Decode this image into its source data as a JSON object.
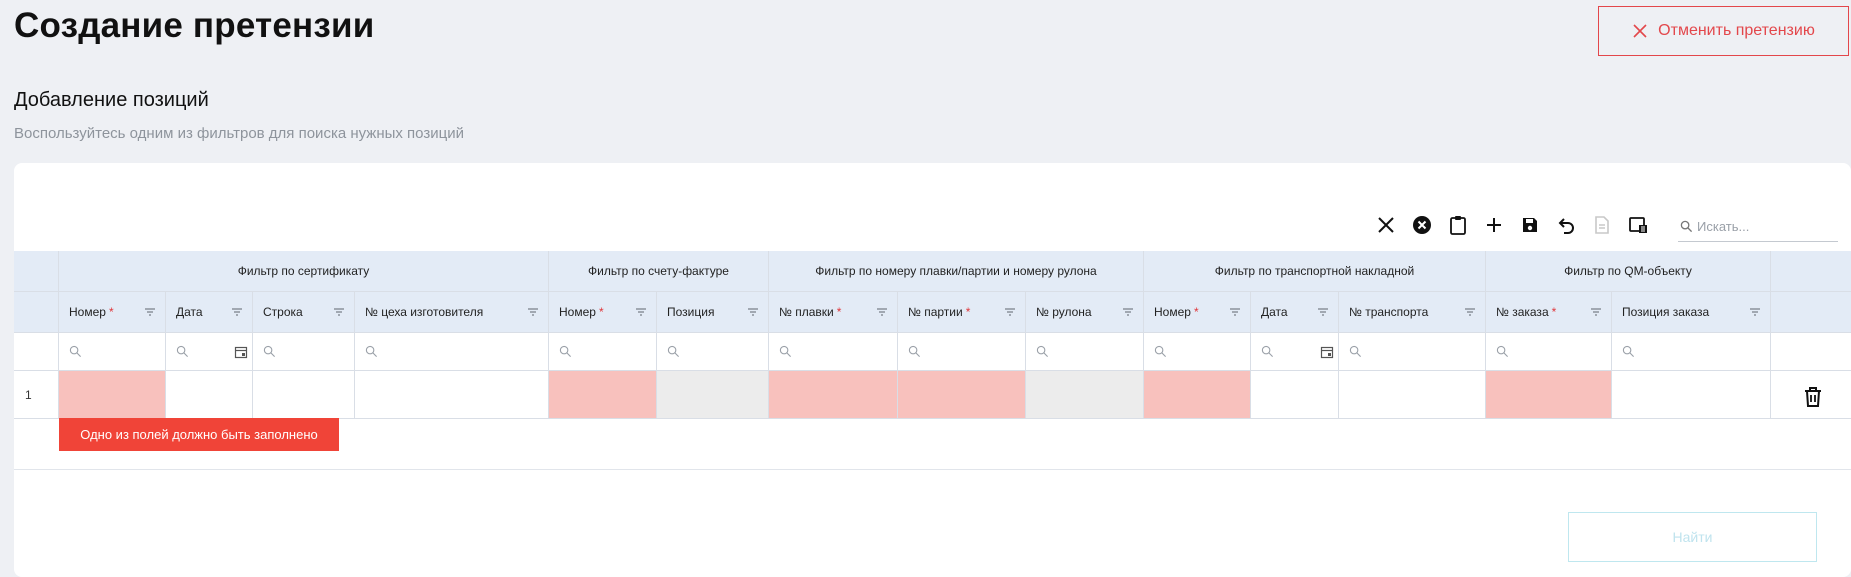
{
  "header": {
    "title": "Создание претензии",
    "cancel_label": "Отменить претензию"
  },
  "section": {
    "title": "Добавление позиций",
    "subtitle": "Воспользуйтесь одним из фильтров для поиска нужных позиций"
  },
  "toolbar": {
    "icons": [
      "close-icon",
      "clear-circle-icon",
      "clipboard-icon",
      "add-icon",
      "save-icon",
      "undo-icon",
      "export-icon",
      "column-settings-icon"
    ],
    "search_placeholder": "Искать..."
  },
  "groups": [
    "Фильтр по сертификату",
    "Фильтр по счету-фактуре",
    "Фильтр по номеру плавки/партии и номеру рулона",
    "Фильтр по транспортной накладной",
    "Фильтр по QM-объекту"
  ],
  "columns": [
    {
      "label": "Номер",
      "required": "*"
    },
    {
      "label": "Дата",
      "required": ""
    },
    {
      "label": "Строка",
      "required": ""
    },
    {
      "label": "№ цеха изготовителя",
      "required": ""
    },
    {
      "label": "Номер",
      "required": "*"
    },
    {
      "label": "Позиция",
      "required": ""
    },
    {
      "label": "№ плавки",
      "required": "*"
    },
    {
      "label": "№ партии",
      "required": "*"
    },
    {
      "label": "№ рулона",
      "required": ""
    },
    {
      "label": "Номер",
      "required": "*"
    },
    {
      "label": "Дата",
      "required": ""
    },
    {
      "label": "№ транспорта",
      "required": ""
    },
    {
      "label": "№ заказа",
      "required": "*"
    },
    {
      "label": "Позиция заказа",
      "required": ""
    }
  ],
  "rows": [
    {
      "num": "1"
    }
  ],
  "error_message": "Одно из полей должно быть заполнено",
  "find_label": "Найти",
  "colors": {
    "accent_red": "#e3474b",
    "error_fill": "#f8c1bd",
    "error_tip": "#f04438",
    "header_bg": "#e3ebf6"
  }
}
